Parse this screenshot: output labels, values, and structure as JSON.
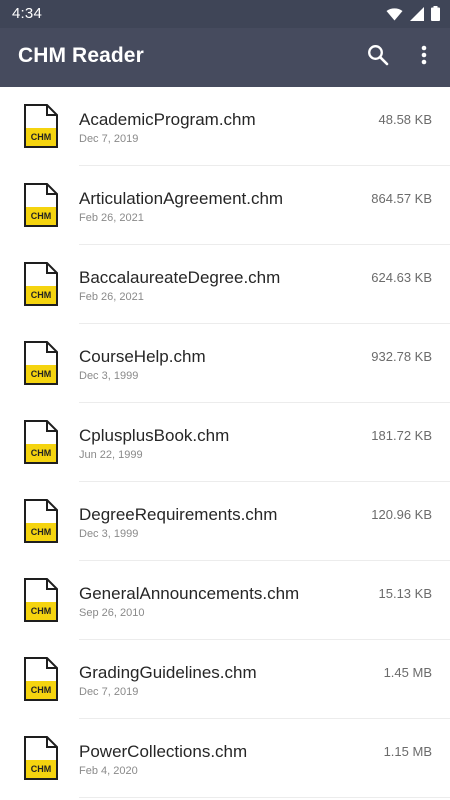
{
  "status_bar": {
    "time": "4:34",
    "icons": [
      "wifi-icon",
      "cellular-signal-icon",
      "battery-icon"
    ]
  },
  "app_bar": {
    "title": "CHM Reader",
    "actions": [
      "search-icon",
      "more-vert-icon"
    ]
  },
  "files": [
    {
      "name": "AcademicProgram.chm",
      "date": "Dec 7, 2019",
      "size": "48.58 KB",
      "icon_label": "CHM"
    },
    {
      "name": "ArticulationAgreement.chm",
      "date": "Feb 26, 2021",
      "size": "864.57 KB",
      "icon_label": "CHM"
    },
    {
      "name": "BaccalaureateDegree.chm",
      "date": "Feb 26, 2021",
      "size": "624.63 KB",
      "icon_label": "CHM"
    },
    {
      "name": "CourseHelp.chm",
      "date": "Dec 3, 1999",
      "size": "932.78 KB",
      "icon_label": "CHM"
    },
    {
      "name": "CplusplusBook.chm",
      "date": "Jun 22, 1999",
      "size": "181.72 KB",
      "icon_label": "CHM"
    },
    {
      "name": "DegreeRequirements.chm",
      "date": "Dec 3, 1999",
      "size": "120.96 KB",
      "icon_label": "CHM"
    },
    {
      "name": "GeneralAnnouncements.chm",
      "date": "Sep 26, 2010",
      "size": "15.13 KB",
      "icon_label": "CHM"
    },
    {
      "name": "GradingGuidelines.chm",
      "date": "Dec 7, 2019",
      "size": "1.45 MB",
      "icon_label": "CHM"
    },
    {
      "name": "PowerCollections.chm",
      "date": "Feb 4, 2020",
      "size": "1.15 MB",
      "icon_label": "CHM"
    }
  ],
  "colors": {
    "status_bar": "#3f4557",
    "app_bar": "#464b5e",
    "icon_label_bg": "#f5d40f"
  }
}
